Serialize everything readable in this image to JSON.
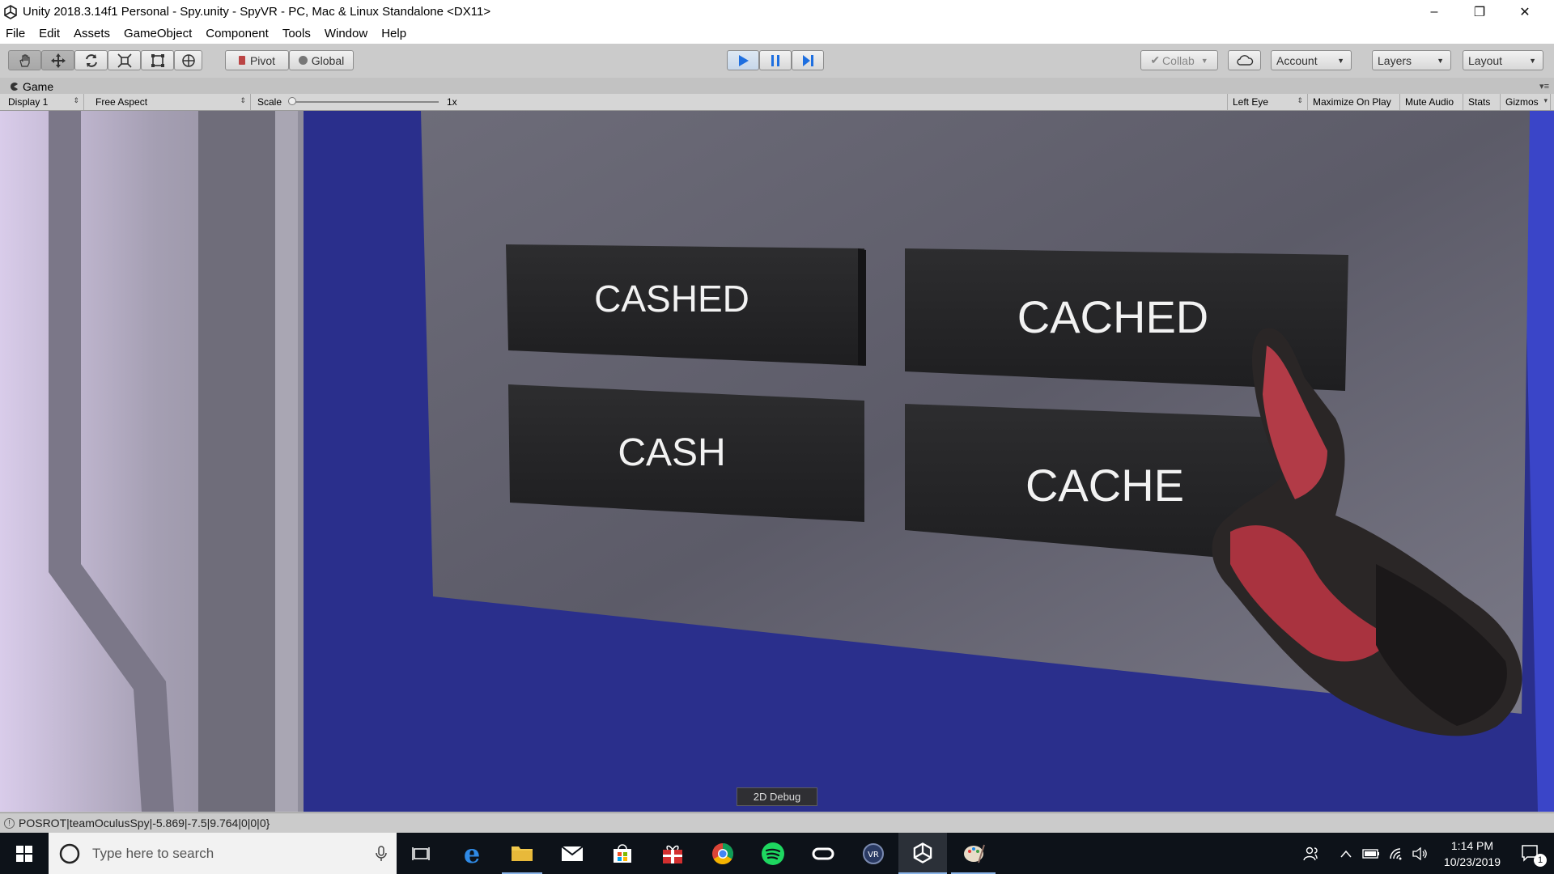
{
  "window": {
    "title": "Unity 2018.3.14f1 Personal - Spy.unity - SpyVR - PC, Mac & Linux Standalone <DX11>"
  },
  "menu": [
    "File",
    "Edit",
    "Assets",
    "GameObject",
    "Component",
    "Tools",
    "Window",
    "Help"
  ],
  "toolbar": {
    "pivot_label": "Pivot",
    "global_label": "Global",
    "collab_label": "Collab",
    "account_label": "Account",
    "layers_label": "Layers",
    "layout_label": "Layout"
  },
  "game_panel": {
    "tab_label": "Game",
    "display_value": "Display 1",
    "aspect_value": "Free Aspect",
    "scale_label": "Scale",
    "scale_value": "1x",
    "scale_fraction": 0,
    "eye_value": "Left Eye",
    "maximize_label": "Maximize On Play",
    "mute_label": "Mute Audio",
    "stats_label": "Stats",
    "gizmos_label": "Gizmos"
  },
  "scene": {
    "buttons": [
      "CASHED",
      "CACHED",
      "CASH",
      "CACHE"
    ],
    "debug_button": "2D Debug"
  },
  "status": {
    "message": "POSROT|teamOculusSpy|-5.869|-7.5|9.764|0|0|0}"
  },
  "taskbar": {
    "search_placeholder": "Type here to search",
    "time": "1:14 PM",
    "date": "10/23/2019",
    "notification_count": "1"
  },
  "colors": {
    "play_blue": "#1e6fe0",
    "scene_blue": "#2a2f8c",
    "taskbar_bg": "#0d1219"
  }
}
